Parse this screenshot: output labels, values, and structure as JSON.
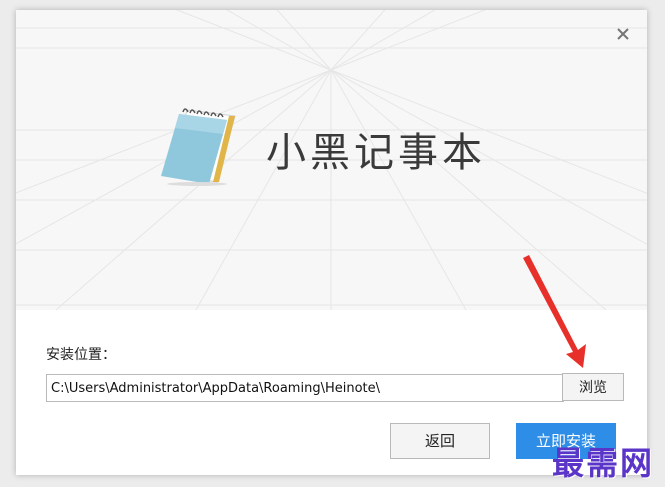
{
  "window": {
    "close_icon": "close-icon"
  },
  "banner": {
    "app_name": "小黑记事本",
    "logo_icon": "notepad-icon"
  },
  "install": {
    "location_label": "安装位置：",
    "path_value": "C:\\Users\\Administrator\\AppData\\Roaming\\Heinote\\",
    "browse_label": "浏览"
  },
  "actions": {
    "back_label": "返回",
    "install_label": "立即安装"
  },
  "watermark": {
    "text": "最需网"
  },
  "colors": {
    "accent": "#2e8de6",
    "arrow": "#e8302a",
    "watermark": "#5a35c8"
  }
}
